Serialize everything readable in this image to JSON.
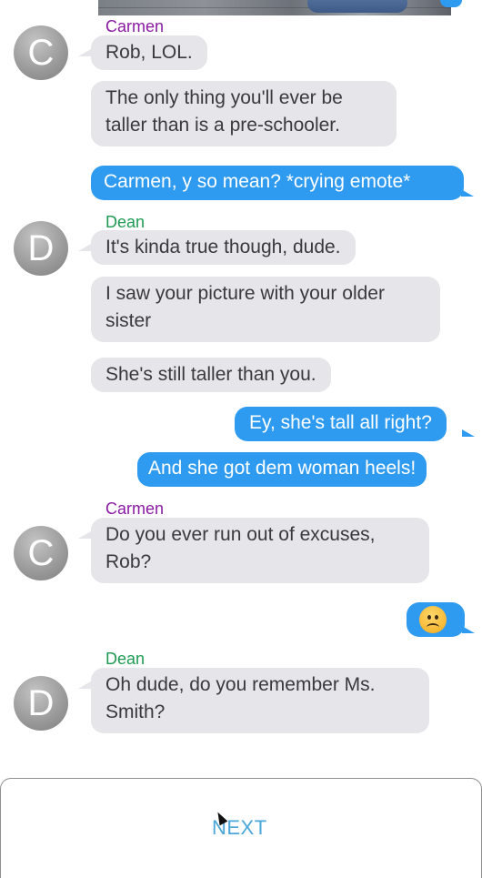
{
  "messages": {
    "carmen_name_1": "Carmen",
    "m1": "Rob, LOL.",
    "m2": "The only thing you'll ever be taller than is a pre-schooler.",
    "m3": "Carmen, y so mean? *crying emote*",
    "dean_name_1": "Dean",
    "m4": "It's kinda true though, dude.",
    "m5": "I saw your picture with your older sister",
    "m6": "She's still taller than you.",
    "m7": "Ey, she's tall all right?",
    "m8": "And she got dem woman heels!",
    "carmen_name_2": "Carmen",
    "m9": "Do you ever run out of excuses, Rob?",
    "m10_emoji": "frowning-face-emoji",
    "dean_name_2": "Dean",
    "m11": "Oh dude, do you remember Ms. Smith?"
  },
  "avatars": {
    "carmen": "C",
    "dean": "D"
  },
  "footer": {
    "next_label": "NEXT"
  },
  "colors": {
    "outgoing_bubble": "#2f9bf0",
    "incoming_bubble": "#e5e5ea",
    "carmen_name": "#8a1aa3",
    "dean_name": "#1f9a52",
    "next_link": "#4aa7da"
  }
}
